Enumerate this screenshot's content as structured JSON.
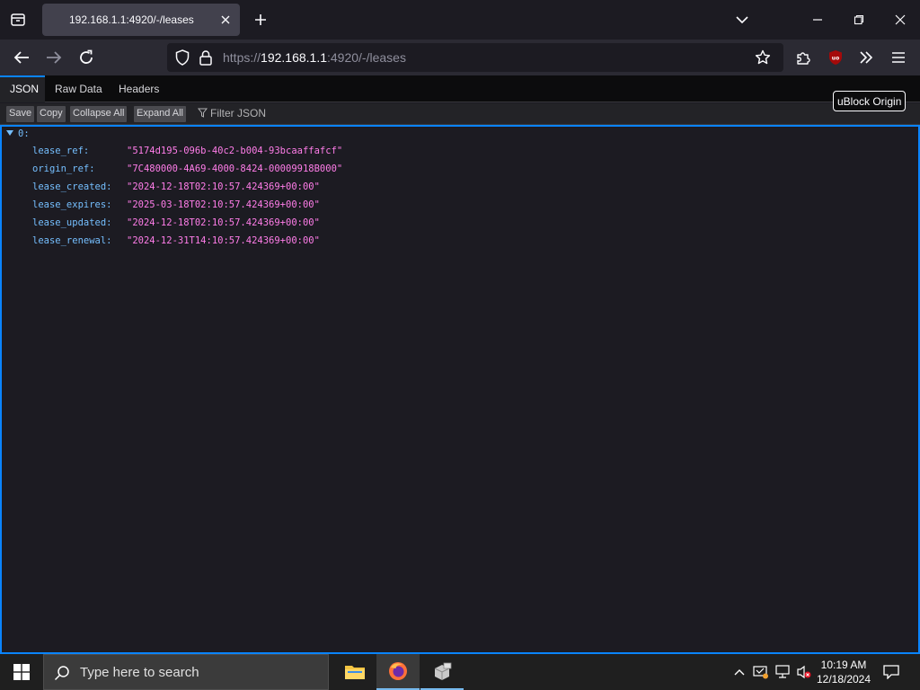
{
  "tabbar": {
    "tab_title": "192.168.1.1:4920/-/leases"
  },
  "navbar": {
    "url_scheme": "https://",
    "url_host": "192.168.1.1",
    "url_rest": ":4920/-/leases"
  },
  "viewer": {
    "tabs": [
      "JSON",
      "Raw Data",
      "Headers"
    ],
    "active_tab": "JSON",
    "toolbar": {
      "save": "Save",
      "copy": "Copy",
      "collapse_all": "Collapse All",
      "expand_all": "Expand All",
      "filter_placeholder": "Filter JSON"
    },
    "tooltip": "uBlock Origin",
    "root_key": "0:",
    "rows": [
      {
        "key": "lease_ref:",
        "value": "\"5174d195-096b-40c2-b004-93bcaaffafcf\""
      },
      {
        "key": "origin_ref:",
        "value": "\"7C480000-4A69-4000-8424-00009918B000\""
      },
      {
        "key": "lease_created:",
        "value": "\"2024-12-18T02:10:57.424369+00:00\""
      },
      {
        "key": "lease_expires:",
        "value": "\"2025-03-18T02:10:57.424369+00:00\""
      },
      {
        "key": "lease_updated:",
        "value": "\"2024-12-18T02:10:57.424369+00:00\""
      },
      {
        "key": "lease_renewal:",
        "value": "\"2024-12-31T14:10:57.424369+00:00\""
      }
    ]
  },
  "taskbar": {
    "search_placeholder": "Type here to search",
    "time": "10:19 AM",
    "date": "12/18/2024"
  },
  "colors": {
    "accent": "#0a84ff",
    "json_key": "#75bfff",
    "json_string": "#ff7de9"
  }
}
